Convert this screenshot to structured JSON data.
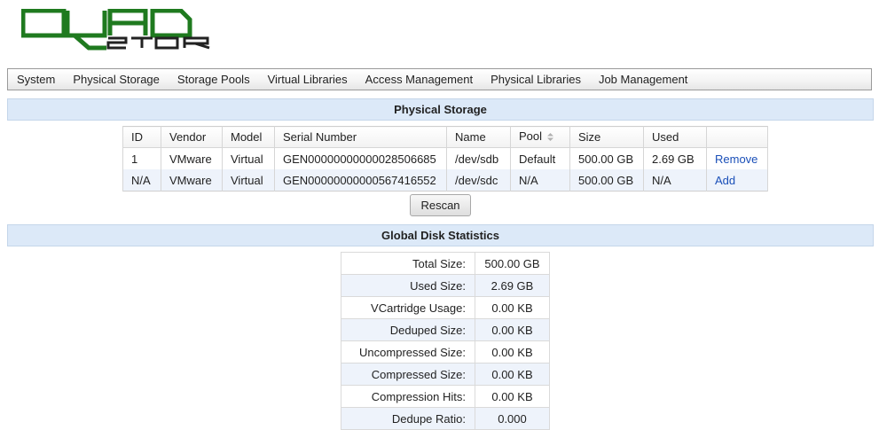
{
  "brand": {
    "logo_text": "QUADSTOR",
    "logo_color": "#1f7a1f"
  },
  "menu": [
    "System",
    "Physical Storage",
    "Storage Pools",
    "Virtual Libraries",
    "Access Management",
    "Physical Libraries",
    "Job Management"
  ],
  "physical_storage": {
    "title": "Physical Storage",
    "columns": [
      "ID",
      "Vendor",
      "Model",
      "Serial Number",
      "Name",
      "Pool",
      "Size",
      "Used",
      ""
    ],
    "rows": [
      {
        "id": "1",
        "vendor": "VMware",
        "model": "Virtual",
        "serial": "GEN00000000000028506685",
        "name": "/dev/sdb",
        "pool": "Default",
        "size": "500.00 GB",
        "used": "2.69 GB",
        "action": "Remove"
      },
      {
        "id": "N/A",
        "vendor": "VMware",
        "model": "Virtual",
        "serial": "GEN00000000000567416552",
        "name": "/dev/sdc",
        "pool": "N/A",
        "size": "500.00 GB",
        "used": "N/A",
        "action": "Add"
      }
    ],
    "rescan_label": "Rescan"
  },
  "global_stats": {
    "title": "Global Disk Statistics",
    "rows": [
      {
        "label": "Total Size:",
        "value": "500.00 GB"
      },
      {
        "label": "Used Size:",
        "value": "2.69 GB"
      },
      {
        "label": "VCartridge Usage:",
        "value": "0.00 KB"
      },
      {
        "label": "Deduped Size:",
        "value": "0.00 KB"
      },
      {
        "label": "Uncompressed Size:",
        "value": "0.00 KB"
      },
      {
        "label": "Compressed Size:",
        "value": "0.00 KB"
      },
      {
        "label": "Compression Hits:",
        "value": "0.00 KB"
      },
      {
        "label": "Dedupe Ratio:",
        "value": "0.000"
      }
    ]
  },
  "colors": {
    "accent": "#dce9f8",
    "link": "#1a4fb8",
    "row_alt": "#eef3fb"
  }
}
